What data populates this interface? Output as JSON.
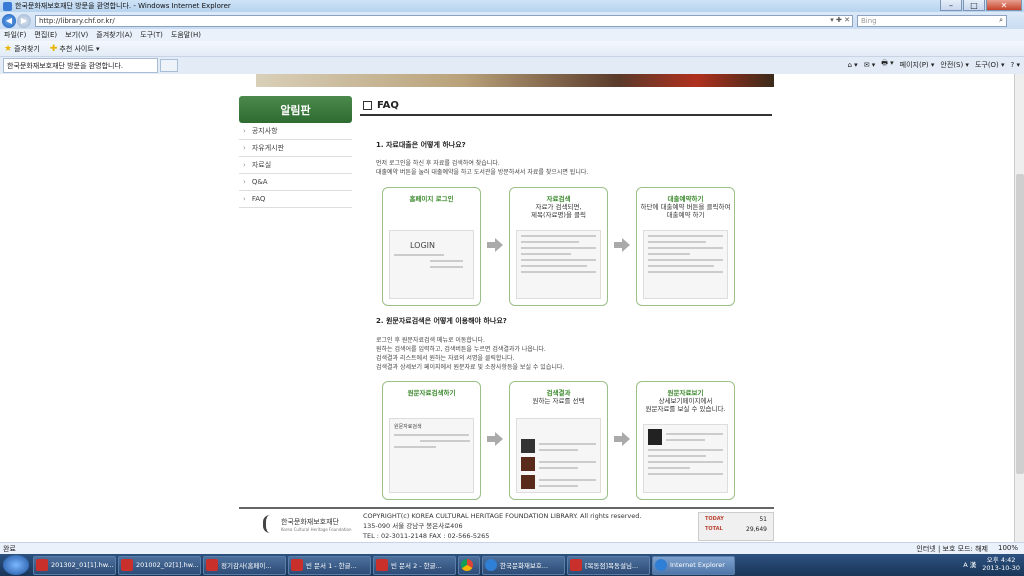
{
  "window": {
    "title": "한국문화재보호재단 방문을 환영합니다. - Windows Internet Explorer",
    "controls": [
      "–",
      "□",
      "✕"
    ]
  },
  "address": {
    "url": "http://library.chf.or.kr/",
    "tools": "▾ ✚ ✕",
    "search_placeholder": "Bing",
    "search_icon": "search-icon"
  },
  "menu": [
    "파일(F)",
    "편집(E)",
    "보기(V)",
    "즐겨찾기(A)",
    "도구(T)",
    "도움말(H)"
  ],
  "favorites": {
    "label": "즐겨찾기",
    "suggested": "추천 사이트 ▾"
  },
  "tab": {
    "title": "한국문화재보호재단 방문을 환영합니다."
  },
  "command_bar": [
    "⌂ ▾",
    "✉ ▾",
    "🖶 ▾",
    "페이지(P) ▾",
    "안전(S) ▾",
    "도구(O) ▾",
    "? ▾"
  ],
  "sidebar": {
    "heading": "알림판",
    "items": [
      {
        "label": "공지사항"
      },
      {
        "label": "자유게시판"
      },
      {
        "label": "자료실"
      },
      {
        "label": "Q&A"
      },
      {
        "label": "FAQ"
      }
    ]
  },
  "main": {
    "heading": "FAQ",
    "q1": {
      "question": "1. 자료대출은 어떻게 하나요?",
      "lines": [
        "먼저 로그인을 하신 후 자료를 검색하여 찾습니다.",
        "대출예약 버튼을 눌러 대출예약을 하고 도서관을 방문하셔서 자료를 찾으시면 됩니다."
      ],
      "cards": [
        {
          "title_green": "홈페이지 로그인",
          "title_rest": "",
          "mock_text": "LOGIN"
        },
        {
          "title_green": "자료검색",
          "title_rest": "자료가 검색되면,\n제목(자료명)을 클릭",
          "mock_text": ""
        },
        {
          "title_green": "대출예약하기",
          "title_rest": "하단에 대출예약 버튼을 클릭하여\n대출예약 하기",
          "mock_text": ""
        }
      ]
    },
    "q2": {
      "question": "2. 원문자료검색은 어떻게 이용해야 하나요?",
      "lines": [
        "로그인 후 원문자료검색 메뉴로 이동합니다.",
        "원하는 검색어를 입력하고, 검색버튼을 누르면 검색결과가 나옵니다.",
        "검색결과 리스트에서 원하는 자료의 서명을 클릭합니다.",
        "검색결과 상세보기 페이지에서 원문자료 및 소장사항등을 보실 수 있습니다."
      ],
      "cards": [
        {
          "title_green": "원문자료검색하기",
          "title_rest": "",
          "mock_text": "원문자료검색"
        },
        {
          "title_green": "검색결과",
          "title_rest": "원하는 자료를 선택",
          "mock_text": ""
        },
        {
          "title_green": "원문자료보기",
          "title_rest": "상세보기페이지에서\n원문자료를 보실 수 있습니다.",
          "mock_text": ""
        }
      ]
    }
  },
  "footer": {
    "org_name": "한국문화재보호재단",
    "org_sub": "Korea Cultural Heritage Foundation",
    "copyright": "COPYRIGHT(c) KOREA CULTURAL HERITAGE FOUNDATION LIBRARY. All rights reserved.",
    "address": "135-090 서울 강남구 봉은사로406",
    "tel": "TEL : 02-3011-2148   FAX : 02-566-5265",
    "today_label": "TODAY",
    "today_value": "51",
    "total_label": "TOTAL",
    "total_value": "29,649"
  },
  "status": {
    "left": "완료",
    "zone": "인터넷 | 보호 모드: 해제",
    "zoom": "100%"
  },
  "taskbar": {
    "tasks": [
      {
        "label": "201302_01[1].hw...",
        "icon": "hwp"
      },
      {
        "label": "201002_02[1].hw...",
        "icon": "hwp"
      },
      {
        "label": "정기감사(홈페이...",
        "icon": "hwp"
      },
      {
        "label": "빈 문서 1 - 한글...",
        "icon": "hwp"
      },
      {
        "label": "빈 문서 2 - 한글...",
        "icon": "hwp"
      },
      {
        "label": "",
        "icon": "chrome"
      },
      {
        "label": "한국문화재보호...",
        "icon": "ie"
      },
      {
        "label": "[목동점]목동설님...",
        "icon": "hwp"
      },
      {
        "label": "Internet Explorer",
        "icon": "ie"
      }
    ],
    "time": "오후 4:42",
    "date": "2013-10-30",
    "ime": "A 漢"
  }
}
